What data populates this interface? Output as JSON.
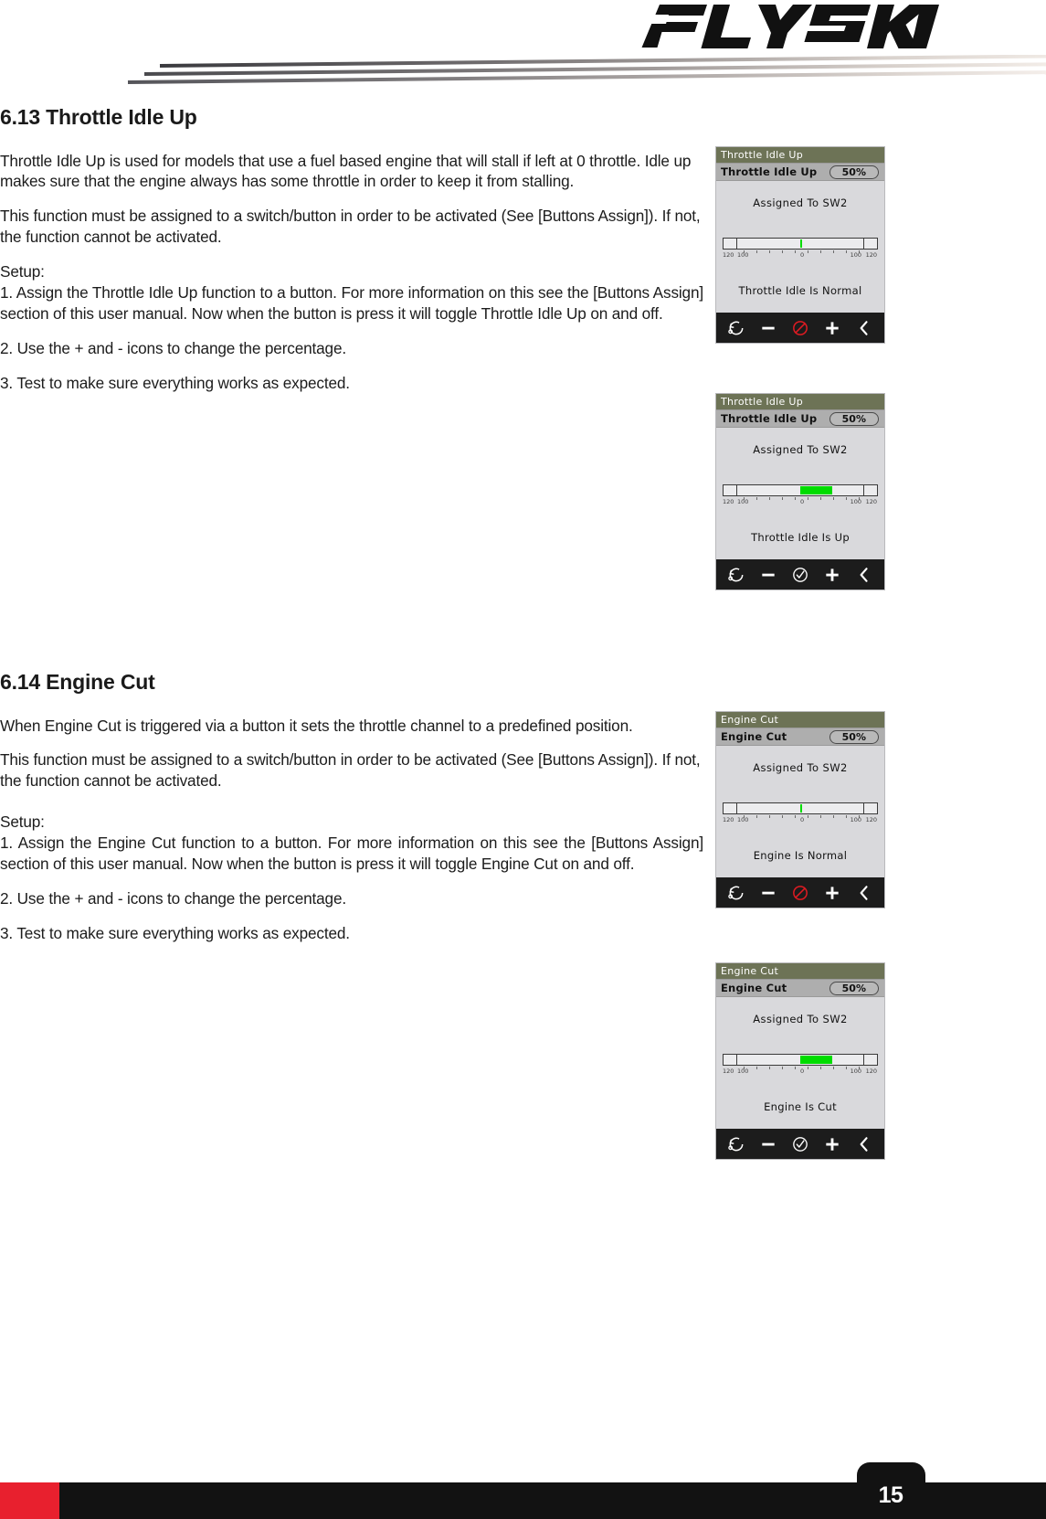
{
  "brand": {
    "logo_text": "FLYSKY"
  },
  "sections": [
    {
      "heading": "6.13 Throttle Idle Up",
      "paragraphs": [
        "Throttle Idle Up is used for models that use a fuel based engine that will stall if left at 0 throttle. Idle up makes sure that the engine always has some throttle in order to keep it from stalling.",
        "This function must be assigned to a switch/button in order to be activated (See [Buttons Assign]). If not, the function cannot be activated.",
        "Setup:\n1. Assign the Throttle Idle Up function to a button. For more information on this see the [Buttons Assign] section of this user manual. Now when the button is press it will toggle Throttle Idle Up on and off.",
        "2. Use the + and - icons to change the percentage.",
        "3. Test to make sure everything works as expected."
      ]
    },
    {
      "heading": "6.14 Engine Cut",
      "paragraphs": [
        "When Engine Cut is triggered via a button it sets the throttle channel to a predefined position.",
        "This function must be assigned to a switch/button in order to be activated (See [Buttons Assign]). If not, the function cannot be activated.",
        "Setup:\n1. Assign the Engine Cut function to a button. For more information on this see the [Buttons Assign] section of this user manual. Now when the button is press it will toggle Engine Cut on and off.",
        "2. Use the + and - icons to change the percentage.",
        "3. Test to make sure everything works as expected."
      ]
    }
  ],
  "screens": [
    {
      "title": "Throttle Idle Up",
      "row_label": "Throttle Idle Up",
      "percent": "50%",
      "assigned": "Assigned To SW2",
      "status": "Throttle Idle Is Normal",
      "gauge": {
        "mode": "marker",
        "value": 0,
        "min": -120,
        "max": 120
      },
      "scale": {
        "left_outer": "120",
        "left_inner": "100",
        "center": "0",
        "right_inner": "100",
        "right_outer": "120"
      },
      "icons": [
        "reset-icon",
        "minus-icon",
        "disabled-icon",
        "plus-icon",
        "back-icon"
      ]
    },
    {
      "title": "Throttle Idle Up",
      "row_label": "Throttle Idle Up",
      "percent": "50%",
      "assigned": "Assigned To SW2",
      "status": "Throttle Idle Is Up",
      "gauge": {
        "mode": "bar",
        "value": 50,
        "min": -120,
        "max": 120
      },
      "scale": {
        "left_outer": "120",
        "left_inner": "100",
        "center": "0",
        "right_inner": "100",
        "right_outer": "120"
      },
      "icons": [
        "reset-icon",
        "minus-icon",
        "enabled-icon",
        "plus-icon",
        "back-icon"
      ]
    },
    {
      "title": "Engine Cut",
      "row_label": "Engine Cut",
      "percent": "50%",
      "assigned": "Assigned To SW2",
      "status": "Engine Is Normal",
      "gauge": {
        "mode": "marker",
        "value": 0,
        "min": -120,
        "max": 120
      },
      "scale": {
        "left_outer": "120",
        "left_inner": "100",
        "center": "0",
        "right_inner": "100",
        "right_outer": "120"
      },
      "icons": [
        "reset-icon",
        "minus-icon",
        "disabled-icon",
        "plus-icon",
        "back-icon"
      ]
    },
    {
      "title": "Engine Cut",
      "row_label": "Engine Cut",
      "percent": "50%",
      "assigned": "Assigned To SW2",
      "status": "Engine Is Cut",
      "gauge": {
        "mode": "bar",
        "value": 50,
        "min": -120,
        "max": 120
      },
      "scale": {
        "left_outer": "120",
        "left_inner": "100",
        "center": "0",
        "right_inner": "100",
        "right_outer": "120"
      },
      "icons": [
        "reset-icon",
        "minus-icon",
        "enabled-icon",
        "plus-icon",
        "back-icon"
      ]
    }
  ],
  "footer": {
    "page_number": "15"
  },
  "colors": {
    "titlebar_green": "#6d7356",
    "subbar_gray": "#aeaeae",
    "lcd_bg": "#d9d9dc",
    "gauge_green": "#00dc00",
    "icon_red": "#e01b22",
    "footer_red": "#e8202e",
    "footer_black": "#121212"
  }
}
